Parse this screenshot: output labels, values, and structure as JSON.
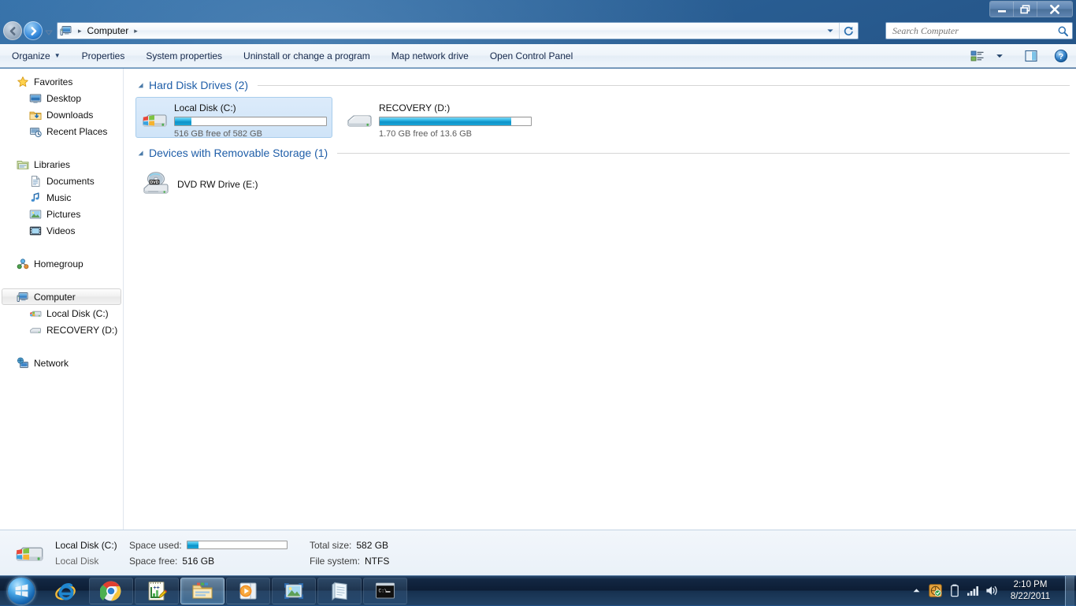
{
  "window": {
    "controls": {
      "minimize": "Minimize",
      "restore": "Restore Down",
      "close": "Close"
    }
  },
  "address_bar": {
    "root_icon": "computer-icon",
    "crumbs": [
      "Computer"
    ],
    "separator": "▸",
    "dropdown_label": "Previous Locations",
    "refresh_label": "Refresh"
  },
  "navigation": {
    "back_label": "Back",
    "forward_label": "Forward",
    "recent_pages_label": "Recent Pages"
  },
  "search": {
    "placeholder": "Search Computer",
    "value": ""
  },
  "toolbar": {
    "items": [
      {
        "label": "Organize",
        "has_dropdown": true
      },
      {
        "label": "Properties",
        "has_dropdown": false
      },
      {
        "label": "System properties",
        "has_dropdown": false
      },
      {
        "label": "Uninstall or change a program",
        "has_dropdown": false
      },
      {
        "label": "Map network drive",
        "has_dropdown": false
      },
      {
        "label": "Open Control Panel",
        "has_dropdown": false
      }
    ],
    "dropdown_caret": "▼",
    "view_label": "Change your view",
    "preview_label": "Show the preview pane",
    "help_label": "Get help"
  },
  "sidebar": {
    "groups": [
      {
        "header": {
          "label": "Favorites",
          "icon": "favorites-star-icon"
        },
        "items": [
          {
            "label": "Desktop",
            "icon": "desktop-icon"
          },
          {
            "label": "Downloads",
            "icon": "downloads-folder-icon"
          },
          {
            "label": "Recent Places",
            "icon": "recent-places-icon"
          }
        ]
      },
      {
        "header": {
          "label": "Libraries",
          "icon": "libraries-icon"
        },
        "items": [
          {
            "label": "Documents",
            "icon": "documents-icon"
          },
          {
            "label": "Music",
            "icon": "music-note-icon"
          },
          {
            "label": "Pictures",
            "icon": "pictures-icon"
          },
          {
            "label": "Videos",
            "icon": "videos-icon"
          }
        ]
      },
      {
        "header": {
          "label": "Homegroup",
          "icon": "homegroup-icon"
        },
        "items": []
      },
      {
        "header": {
          "label": "Computer",
          "icon": "computer-icon",
          "selected": true
        },
        "items": [
          {
            "label": "Local Disk (C:)",
            "icon": "system-drive-icon"
          },
          {
            "label": "RECOVERY (D:)",
            "icon": "hard-drive-icon"
          }
        ]
      },
      {
        "header": {
          "label": "Network",
          "icon": "network-icon"
        },
        "items": []
      }
    ]
  },
  "content": {
    "groups": [
      {
        "title": "Hard Disk Drives (2)",
        "collapsed": false,
        "drives": [
          {
            "name": "Local Disk (C:)",
            "free_text": "516 GB free of 582 GB",
            "free_gb": 516,
            "total_gb": 582,
            "used_percent": 11,
            "icon": "system-drive-icon",
            "selected": true
          },
          {
            "name": "RECOVERY (D:)",
            "free_text": "1.70 GB free of 13.6 GB",
            "free_gb": 1.7,
            "total_gb": 13.6,
            "used_percent": 87,
            "icon": "hard-drive-icon",
            "selected": false
          }
        ]
      },
      {
        "title": "Devices with Removable Storage (1)",
        "collapsed": false,
        "devices": [
          {
            "name": "DVD RW Drive (E:)",
            "icon": "dvd-drive-icon"
          }
        ]
      }
    ]
  },
  "details_pane": {
    "icon": "system-drive-icon",
    "title": "Local Disk (C:)",
    "subtitle": "Local Disk",
    "space_used_label": "Space used:",
    "space_used_percent": 11,
    "space_free_label": "Space free:",
    "space_free_value": "516 GB",
    "total_size_label": "Total size:",
    "total_size_value": "582 GB",
    "file_system_label": "File system:",
    "file_system_value": "NTFS"
  },
  "taskbar": {
    "start_label": "Start",
    "buttons": [
      {
        "name": "internet-explorer",
        "label": "Internet Explorer",
        "state": "pinned"
      },
      {
        "name": "google-chrome",
        "label": "Google Chrome",
        "state": "normal"
      },
      {
        "name": "notepad-plus-plus",
        "label": "Notepad++",
        "state": "normal"
      },
      {
        "name": "windows-explorer",
        "label": "Windows Explorer",
        "state": "active"
      },
      {
        "name": "media-player",
        "label": "Windows Media Player",
        "state": "normal"
      },
      {
        "name": "photo-viewer",
        "label": "Windows Photo Viewer",
        "state": "normal"
      },
      {
        "name": "notepad",
        "label": "Notepad",
        "state": "normal"
      },
      {
        "name": "command-prompt",
        "label": "Command Prompt",
        "state": "normal"
      }
    ],
    "tray": {
      "overflow_label": "Show hidden icons",
      "icons": [
        {
          "name": "action-center-icon",
          "label": "Action Center"
        },
        {
          "name": "battery-icon",
          "label": "Battery"
        },
        {
          "name": "network-signal-icon",
          "label": "Network"
        },
        {
          "name": "volume-icon",
          "label": "Volume"
        }
      ],
      "time": "2:10 PM",
      "date": "8/22/2011"
    },
    "show_desktop_label": "Show desktop"
  },
  "colors": {
    "accent_blue": "#1f5ea8",
    "bar_fill": "#1aa6d8",
    "selection": "#cfe4f8",
    "taskbar": "#12263f",
    "desktop": "#27598d"
  }
}
